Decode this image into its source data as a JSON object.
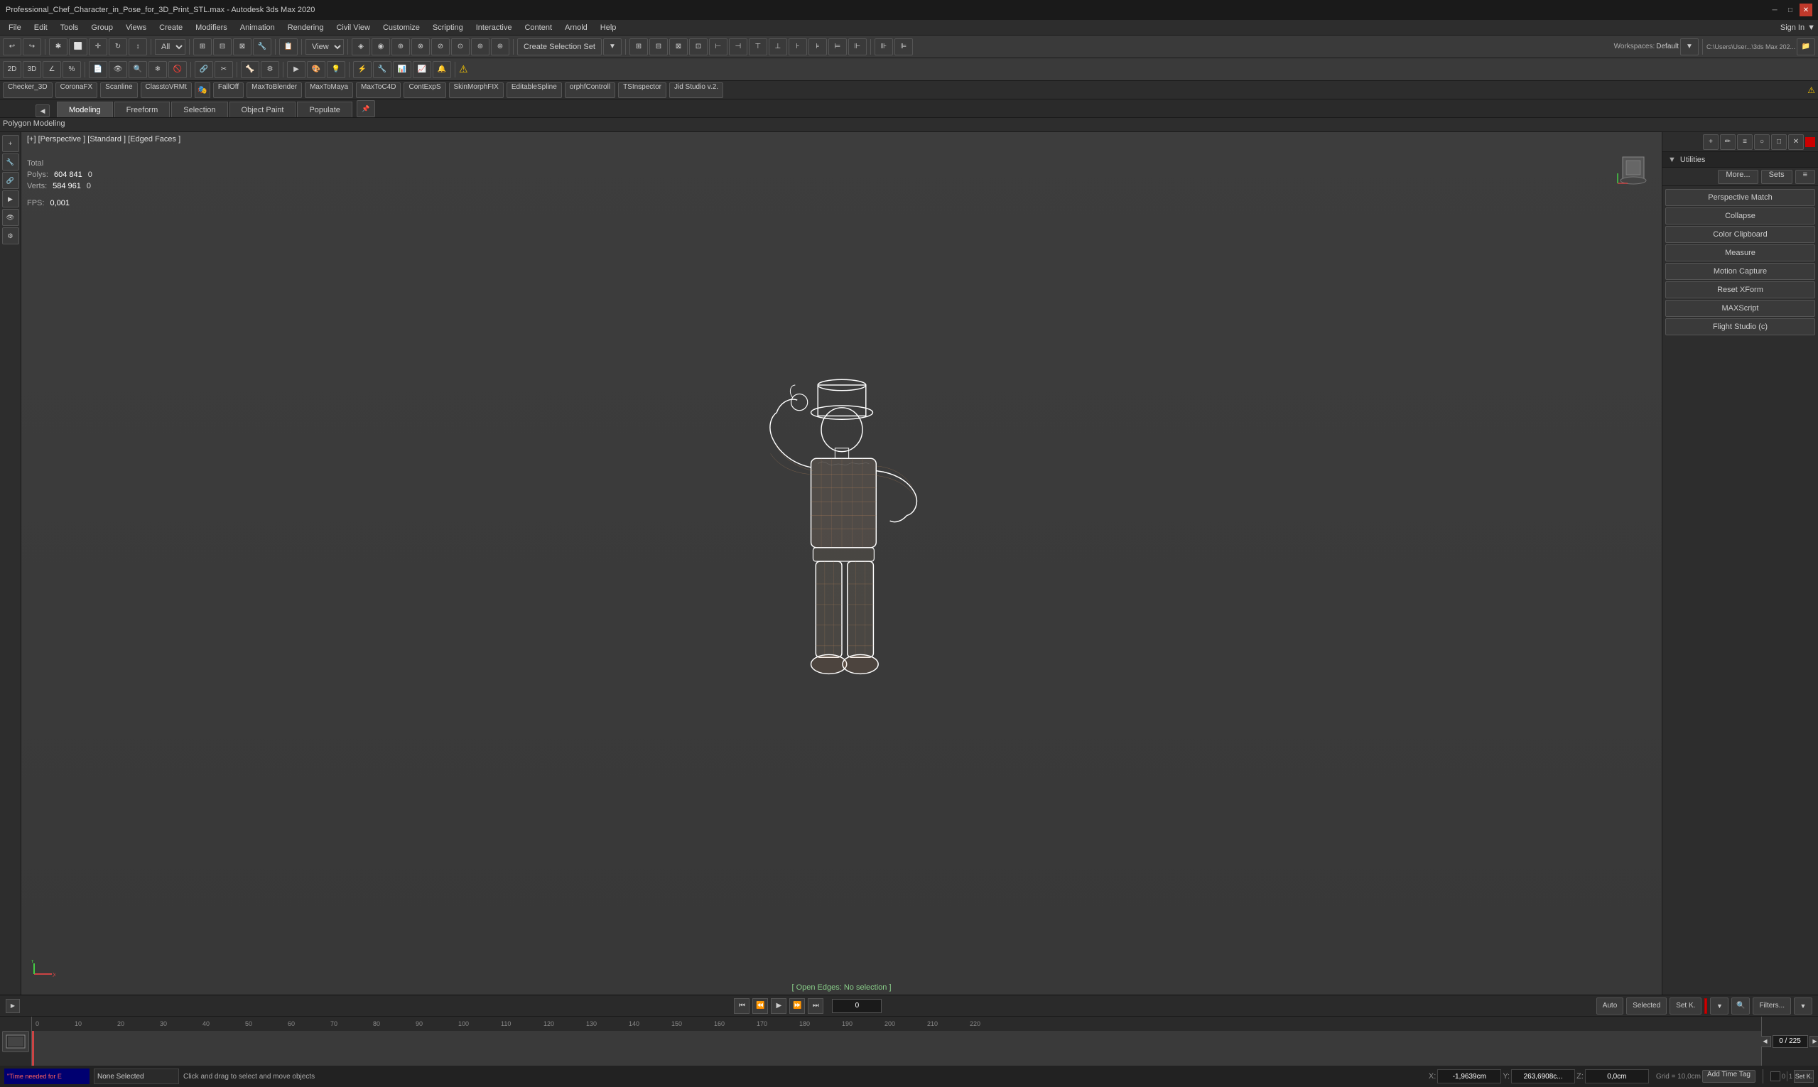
{
  "titlebar": {
    "title": "Professional_Chef_Character_in_Pose_for_3D_Print_STL.max - Autodesk 3ds Max 2020",
    "minimize": "─",
    "maximize": "□",
    "close": "✕"
  },
  "menu": {
    "items": [
      "File",
      "Edit",
      "Tools",
      "Group",
      "Views",
      "Create",
      "Modifiers",
      "Animation",
      "Rendering",
      "Civil View",
      "Customize",
      "Scripting",
      "Interactive",
      "Content",
      "Arnold",
      "Help"
    ]
  },
  "toolbar1": {
    "undo_label": "↩",
    "redo_label": "↪",
    "select_all": "All",
    "view_btn": "View",
    "create_selection_set": "Create Selection Set",
    "workspace_label": "Workspaces:",
    "workspace_value": "Default",
    "path_label": "C:\\Users\\User...\\3ds Max 202..."
  },
  "tabs": {
    "items": [
      "Modeling",
      "Freeform",
      "Selection",
      "Object Paint",
      "Populate"
    ],
    "active": 0,
    "sub_label": "Polygon Modeling"
  },
  "viewport": {
    "header": "[+] [Perspective ] [Standard ] [Edged Faces ]",
    "stats": {
      "total_label": "Total",
      "polys_label": "Polys:",
      "polys_value": "604 841",
      "polys_zero": "0",
      "verts_label": "Verts:",
      "verts_value": "584 961",
      "verts_zero": "0",
      "fps_label": "FPS:",
      "fps_value": "0,001"
    },
    "footer": "[ Open Edges: No selection ]"
  },
  "utilities": {
    "header": "Utilities",
    "buttons": {
      "more": "More...",
      "sets": "Sets",
      "list_icon": "≡"
    },
    "items": [
      "Perspective Match",
      "Collapse",
      "Color Clipboard",
      "Measure",
      "Motion Capture",
      "Reset XForm",
      "MAXScript",
      "Flight Studio (c)"
    ]
  },
  "timeline": {
    "frame_display": "0 / 225",
    "play_icon": "▶",
    "nav_icons": [
      "⏮",
      "⏪",
      "▶",
      "⏩",
      "⏭"
    ],
    "numbers": [
      "0",
      "10",
      "20",
      "30",
      "40",
      "50",
      "60",
      "70",
      "80",
      "90",
      "100",
      "110",
      "120",
      "130",
      "140",
      "150",
      "160",
      "170",
      "180",
      "190",
      "200",
      "210",
      "220"
    ]
  },
  "statusbar": {
    "error_text": "\"Time needed for E",
    "selected_label": "None Selected",
    "message": "Click and drag to select and move objects",
    "x_label": "X:",
    "x_value": "-1,9639cm",
    "y_label": "Y:",
    "y_value": "263,6908c...",
    "z_label": "Z:",
    "z_value": "0,0cm",
    "grid_label": "Grid = 10,0cm",
    "add_time_tag": "Add Time Tag",
    "auto_label": "Auto",
    "selected_btn": "Selected",
    "set_k_label": "Set K.",
    "filters_label": "Filters..."
  },
  "plugins": {
    "items": [
      "Checker_3D",
      "CoronaFX",
      "Scanline",
      "ClasstoVRMt",
      "FallOff",
      "MaxToBlender",
      "MaxToMaya",
      "MaxToC4D",
      "ContExpS",
      "SkinMorphFIX",
      "EditableSpline",
      "orphfControll",
      "TSInspector",
      "Jid Studio v.2."
    ]
  }
}
